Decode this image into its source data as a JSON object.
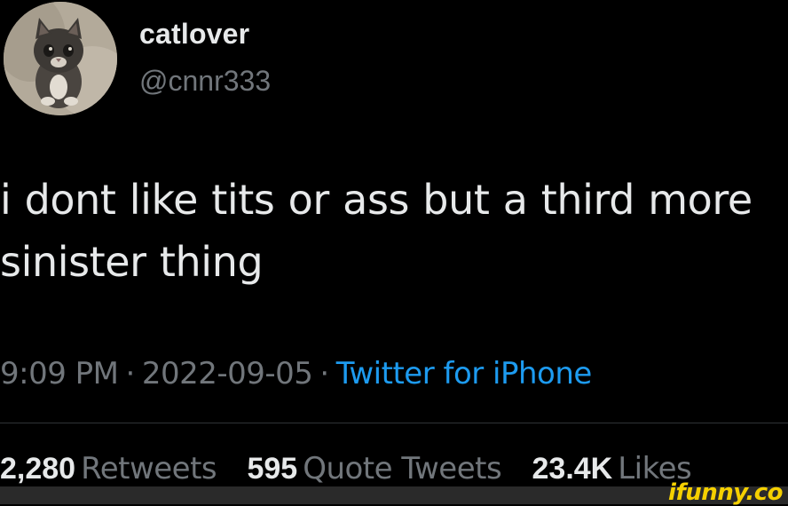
{
  "user": {
    "display_name": "catlover",
    "handle": "@cnnr333",
    "avatar_icon": "kitten-avatar"
  },
  "tweet": {
    "text_lines": [
      "i dont like tits or ass but a third more",
      "sinister thing"
    ],
    "time": "9:09 PM",
    "separator": "·",
    "date": "2022-09-05",
    "source": "Twitter for iPhone"
  },
  "stats": {
    "retweets": {
      "count": "2,280",
      "label": "Retweets"
    },
    "quote_tweets": {
      "count": "595",
      "label": "Quote Tweets"
    },
    "likes": {
      "count": "23.4K",
      "label": "Likes"
    }
  },
  "watermark": "ifunny.co",
  "colors": {
    "background": "#000000",
    "primary_text": "#e7e9ea",
    "secondary_text": "#71767b",
    "link": "#1d9bf0",
    "watermark": "#f5d000"
  }
}
